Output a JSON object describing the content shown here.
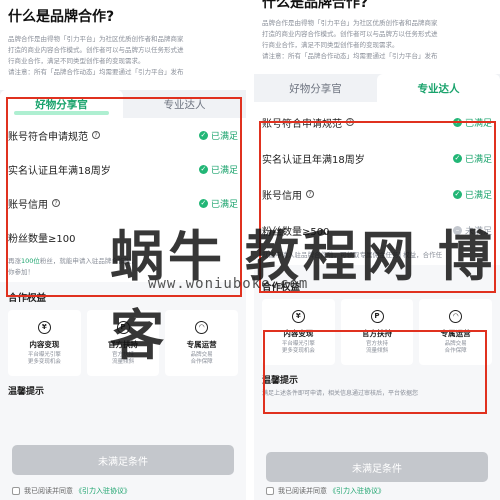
{
  "left": {
    "title": "什么是品牌合作?",
    "intro_lines": [
      "品牌合作是由得物「引力平台」为社区优质创作者和品牌商家",
      "打造的商业内容合作模式。创作者可以与品牌方以任务形式进",
      "行商业合作，满足不同类型创作者的变现需求。",
      "请注意：所有「品牌合作动态」均需要通过「引力平台」发布"
    ],
    "tabs": [
      "好物分享官",
      "专业达人"
    ],
    "conditions": [
      {
        "label": "账号符合申请规范",
        "help": "?",
        "status": "已满足"
      },
      {
        "label": "实名认证且年满18周岁",
        "help": "",
        "status": "已满足"
      },
      {
        "label": "账号信用",
        "help": "?",
        "status": "已满足"
      },
      {
        "label": "粉丝数量≥100",
        "help": "",
        "status": ""
      }
    ],
    "note_parts": [
      "再涨",
      "100位",
      "粉丝，就能申请入驻品牌合作啦，"
    ],
    "note_line2": "你参加！",
    "benefits_title": "合作权益",
    "benefits": [
      {
        "icon": "¥",
        "title": "内容变现",
        "sub": "平台曝光引擎\n更多变现机会"
      },
      {
        "icon": "P",
        "title": "官方扶持",
        "sub": "官方扶持\n流量倾斜"
      },
      {
        "icon": "◠",
        "title": "专属运营",
        "sub": "品牌交易\n合作保障"
      }
    ],
    "tips_title": "温馨提示",
    "submit_label": "未满足条件",
    "agree_text": "我已阅读并同意",
    "agree_link": "《引力入驻协议》"
  },
  "right": {
    "title": "什么是品牌合作?",
    "intro_lines": [
      "品牌合作是由得物「引力平台」为社区优质创作者和品牌商家",
      "打造的商业内容合作模式。创作者可以与品牌方以任务形式进",
      "行商业合作，满足不同类型创作者的变现需求。",
      "请注意：所有「品牌合作动态」均需要通过「引力平台」发布"
    ],
    "tabs": [
      "好物分享官",
      "专业达人"
    ],
    "conditions": [
      {
        "label": "账号符合申请规范",
        "help": "?",
        "status": "已满足"
      },
      {
        "label": "实名认证且年满18周岁",
        "help": "",
        "status": "已满足"
      },
      {
        "label": "账号信用",
        "help": "?",
        "status": "已满足"
      },
      {
        "label": "粉丝数量≥500",
        "help": "",
        "status": "未满足"
      }
    ],
    "note_text": "就能申请入驻品牌合作啦，可领取专属佣金任务] 权益，合作任",
    "benefits_title": "合作权益",
    "benefits": [
      {
        "icon": "¥",
        "title": "内容变现",
        "sub": "平台曝光引擎\n更多变现机会"
      },
      {
        "icon": "P",
        "title": "官方扶持",
        "sub": "官方扶持\n流量倾斜"
      },
      {
        "icon": "◠",
        "title": "专属运营",
        "sub": "品牌交易\n合作保障"
      }
    ],
    "tips_title": "温馨提示",
    "tips_text": "满足上述条件即可申请，相关信息通过审核后，平台依据您",
    "submit_label": "未满足条件",
    "agree_text": "我已阅读并同意",
    "agree_link": "《引力入驻协议》"
  },
  "watermark": {
    "title": "蜗牛 教程网 博客",
    "url": "www.woniuboke.com"
  },
  "colors": {
    "accent_green": "#1aa36c",
    "annotation_red": "#e0311f",
    "disabled_button": "#c4c7cc"
  }
}
